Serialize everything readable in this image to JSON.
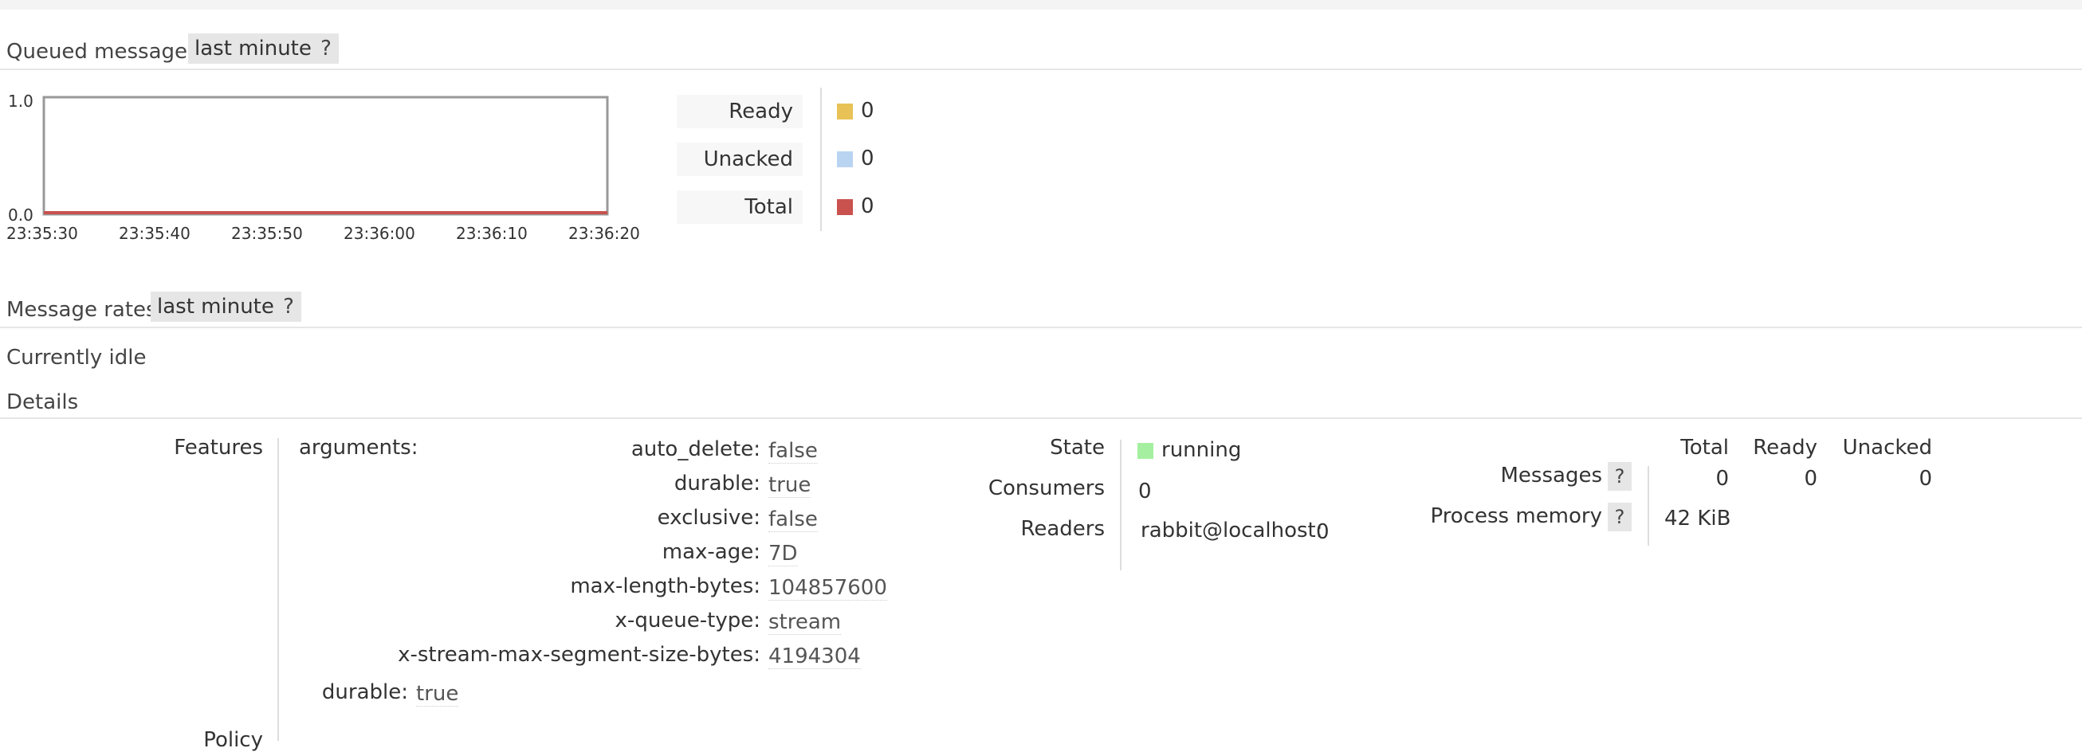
{
  "queued": {
    "title": "Queued messages",
    "range_label": "last minute",
    "help_label": "?",
    "chart_data": {
      "type": "area",
      "x": [
        "23:35:30",
        "23:35:40",
        "23:35:50",
        "23:36:00",
        "23:36:10",
        "23:36:20"
      ],
      "series": [
        {
          "name": "Ready",
          "values": [
            0,
            0,
            0,
            0,
            0,
            0
          ],
          "color": "#e8c256"
        },
        {
          "name": "Unacked",
          "values": [
            0,
            0,
            0,
            0,
            0,
            0
          ],
          "color": "#b8d4f0"
        },
        {
          "name": "Total",
          "values": [
            0,
            0,
            0,
            0,
            0,
            0
          ],
          "color": "#c9524e"
        }
      ],
      "ylim": [
        0,
        1.0
      ],
      "ytick_labels": [
        "0.0",
        "1.0"
      ],
      "xlabel": "",
      "ylabel": ""
    },
    "legend": [
      {
        "label": "Ready",
        "value": "0",
        "color": "#e8c256"
      },
      {
        "label": "Unacked",
        "value": "0",
        "color": "#b8d4f0"
      },
      {
        "label": "Total",
        "value": "0",
        "color": "#c9524e"
      }
    ]
  },
  "rates": {
    "title": "Message rates",
    "range_label": "last minute",
    "help_label": "?",
    "status": "Currently idle"
  },
  "details": {
    "title": "Details",
    "features_label": "Features",
    "arguments_label": "arguments:",
    "arguments": [
      {
        "key": "auto_delete:",
        "value": "false"
      },
      {
        "key": "durable:",
        "value": "true"
      },
      {
        "key": "exclusive:",
        "value": "false"
      },
      {
        "key": "max-age:",
        "value": "7D"
      },
      {
        "key": "max-length-bytes:",
        "value": "104857600"
      },
      {
        "key": "x-queue-type:",
        "value": "stream"
      },
      {
        "key": "x-stream-max-segment-size-bytes:",
        "value": "4194304"
      }
    ],
    "durable_label": "durable:",
    "durable_value": "true",
    "policy_label": "Policy",
    "state_label": "State",
    "state_value": "running",
    "state_color": "#a4f0a0",
    "consumers_label": "Consumers",
    "consumers_value": "0",
    "readers_label": "Readers",
    "readers_node": "rabbit@localhost:",
    "readers_value": "0",
    "stats_headers": [
      "Total",
      "Ready",
      "Unacked"
    ],
    "messages_label": "Messages",
    "messages_values": [
      "0",
      "0",
      "0"
    ],
    "process_memory_label": "Process memory",
    "process_memory_value": "42 KiB",
    "help_label": "?"
  }
}
